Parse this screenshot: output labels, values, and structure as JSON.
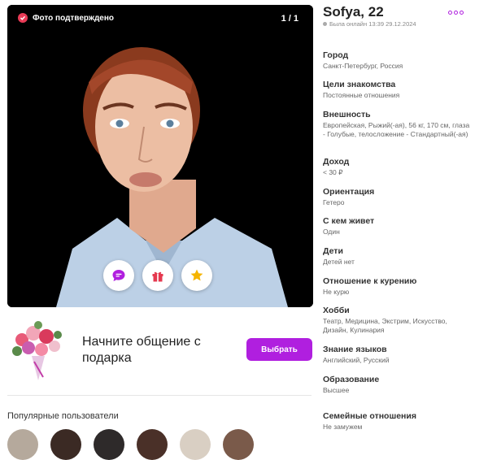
{
  "photo": {
    "verified_label": "Фото подтверждено",
    "counter": "1 / 1",
    "actions": [
      {
        "icon": "message-icon"
      },
      {
        "icon": "gift-icon"
      },
      {
        "icon": "star-icon"
      }
    ]
  },
  "gift_banner": {
    "text": "Начните общение с подарка",
    "button_label": "Выбрать"
  },
  "popular": {
    "title": "Популярные пользователи"
  },
  "profile": {
    "name": "Sofya, 22",
    "last_online": "Была онлайн 13:39 29.12.2024",
    "fields": [
      {
        "label": "Город",
        "value": "Санкт-Петербург, Россия"
      },
      {
        "label": "Цели знакомства",
        "value": "Постоянные отношения"
      },
      {
        "label": "Внешность",
        "value": "Европейская, Рыжий(-ая), 56 кг, 170 см, глаза - Голубые, телосложение - Стандартный(-ая)"
      },
      {
        "label": "Доход",
        "value": "< 30 ₽"
      },
      {
        "label": "Ориентация",
        "value": "Гетеро"
      },
      {
        "label": "С кем живет",
        "value": "Один"
      },
      {
        "label": "Дети",
        "value": "Детей нет"
      },
      {
        "label": "Отношение к курению",
        "value": "Не курю"
      },
      {
        "label": "Хобби",
        "value": "Театр, Медицина, Экстрим, Искусство, Дизайн, Кулинария"
      },
      {
        "label": "Знание языков",
        "value": "Английский, Русский"
      },
      {
        "label": "Образование",
        "value": "Высшее"
      },
      {
        "label": "Семейные отношения",
        "value": "Не замужем"
      }
    ]
  },
  "colors": {
    "accent": "#b01fdf",
    "verified": "#e83b56"
  }
}
